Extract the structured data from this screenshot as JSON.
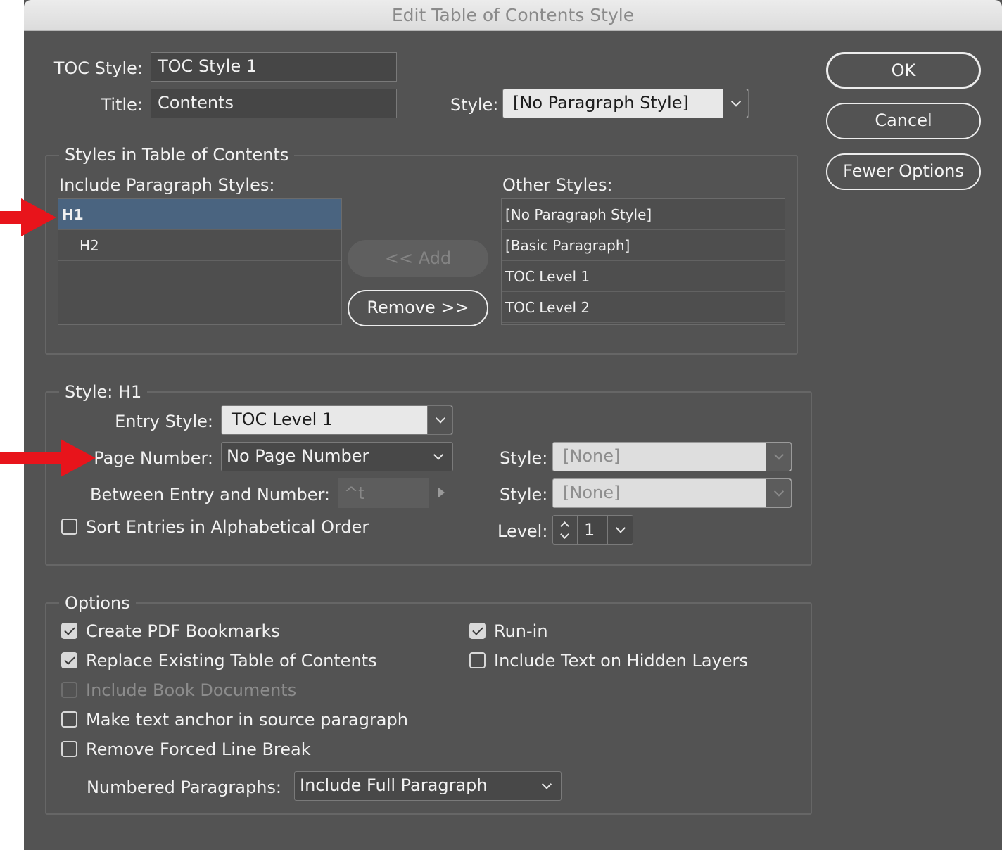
{
  "window": {
    "title": "Edit Table of Contents Style"
  },
  "buttons": {
    "ok": "OK",
    "cancel": "Cancel",
    "fewer_options": "Fewer Options"
  },
  "top": {
    "toc_style_label": "TOC Style:",
    "toc_style_value": "TOC Style 1",
    "title_label": "Title:",
    "title_value": "Contents",
    "style_label": "Style:",
    "style_value": "[No Paragraph Style]"
  },
  "styles_group": {
    "title": "Styles in Table of Contents",
    "include_label": "Include Paragraph Styles:",
    "include_items": [
      {
        "label": "H1",
        "selected": true
      },
      {
        "label": "H2",
        "selected": false
      }
    ],
    "add_button": "<< Add",
    "remove_button": "Remove >>",
    "other_label": "Other Styles:",
    "other_items": [
      "[No Paragraph Style]",
      "[Basic Paragraph]",
      "TOC Level 1",
      "TOC Level 2"
    ]
  },
  "style_group": {
    "title": "Style: H1",
    "entry_style_label": "Entry Style:",
    "entry_style_value": "TOC Level 1",
    "page_number_label": "Page Number:",
    "page_number_value": "No Page Number",
    "between_label": "Between Entry and Number:",
    "between_value": "^t",
    "sort_label": "Sort Entries in Alphabetical Order",
    "sort_checked": false,
    "style1_label": "Style:",
    "style1_value": "[None]",
    "style2_label": "Style:",
    "style2_value": "[None]",
    "level_label": "Level:",
    "level_value": "1"
  },
  "options_group": {
    "title": "Options",
    "create_pdf_bookmarks": {
      "label": "Create PDF Bookmarks",
      "checked": true
    },
    "replace_existing": {
      "label": "Replace Existing Table of Contents",
      "checked": true
    },
    "include_book_documents": {
      "label": "Include Book Documents",
      "checked": false,
      "disabled": true
    },
    "make_text_anchor": {
      "label": "Make text anchor in source paragraph",
      "checked": false
    },
    "remove_forced_line_break": {
      "label": "Remove Forced Line Break",
      "checked": false
    },
    "run_in": {
      "label": "Run-in",
      "checked": true
    },
    "include_hidden_layers": {
      "label": "Include Text on Hidden Layers",
      "checked": false
    },
    "numbered_paragraphs_label": "Numbered Paragraphs:",
    "numbered_paragraphs_value": "Include Full Paragraph"
  },
  "colors": {
    "dialog_bg": "#535353",
    "selection": "#4a6480",
    "annotation_arrow": "#e8141b"
  }
}
